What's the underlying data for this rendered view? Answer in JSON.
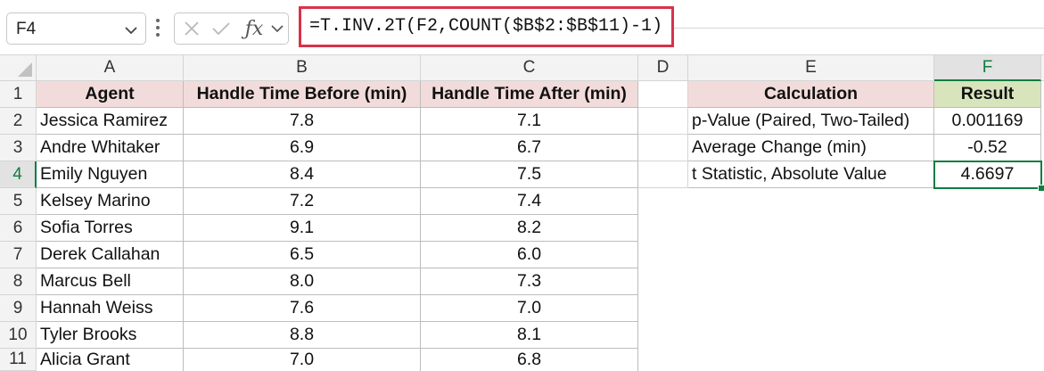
{
  "name_box": {
    "value": "F4"
  },
  "formula_bar": {
    "formula": "=T.INV.2T(F2,COUNT($B$2:$B$11)-1)"
  },
  "icons": {
    "name_box_dropdown": "chevron-down-icon",
    "more": "vertical-ellipsis-icon",
    "cancel": "close-icon",
    "enter": "check-icon",
    "insert_function": "fx-icon",
    "expand": "chevron-down-icon"
  },
  "column_headers": [
    "A",
    "B",
    "C",
    "D",
    "E",
    "F"
  ],
  "row_headers": [
    "1",
    "2",
    "3",
    "4",
    "5",
    "6",
    "7",
    "8",
    "9",
    "10",
    "11"
  ],
  "selected": {
    "column": "F",
    "row": "4"
  },
  "colors": {
    "header_fill": "#f2dcdb",
    "result_fill": "#d8e4bc",
    "accent": "#107c41",
    "formula_highlight": "#d8324a"
  },
  "table": {
    "headers": [
      "Agent",
      "Handle Time Before (min)",
      "Handle Time After (min)"
    ],
    "rows": [
      [
        "Jessica Ramirez",
        "7.8",
        "7.1"
      ],
      [
        "Andre Whitaker",
        "6.9",
        "6.7"
      ],
      [
        "Emily Nguyen",
        "8.4",
        "7.5"
      ],
      [
        "Kelsey Marino",
        "7.2",
        "7.4"
      ],
      [
        "Sofia Torres",
        "9.1",
        "8.2"
      ],
      [
        "Derek Callahan",
        "6.5",
        "6.0"
      ],
      [
        "Marcus Bell",
        "8.0",
        "7.3"
      ],
      [
        "Hannah Weiss",
        "7.6",
        "7.0"
      ],
      [
        "Tyler Brooks",
        "8.8",
        "8.1"
      ],
      [
        "Alicia Grant",
        "7.0",
        "6.8"
      ]
    ]
  },
  "summary": {
    "headers": [
      "Calculation",
      "Result"
    ],
    "rows": [
      [
        "p-Value (Paired, Two-Tailed)",
        "0.001169"
      ],
      [
        "Average Change (min)",
        "-0.52"
      ],
      [
        "t Statistic, Absolute Value",
        "4.6697"
      ]
    ]
  }
}
